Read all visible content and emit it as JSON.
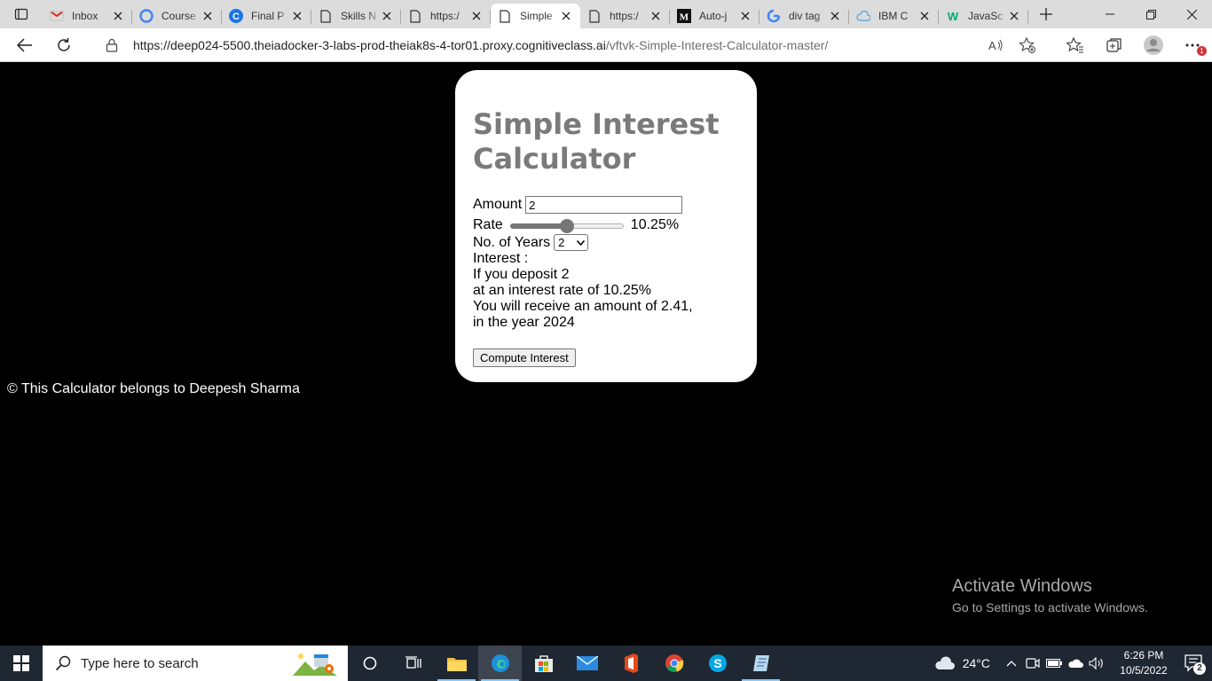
{
  "browser": {
    "tabs": [
      {
        "label": "Inbox",
        "favicon": "gmail-icon"
      },
      {
        "label": "Course",
        "favicon": "google-classroom-icon"
      },
      {
        "label": "Final P",
        "favicon": "circle-c-icon"
      },
      {
        "label": "Skills N",
        "favicon": "page-icon"
      },
      {
        "label": "https:/",
        "favicon": "page-icon"
      },
      {
        "label": "Simple",
        "favicon": "page-icon",
        "active": true
      },
      {
        "label": "https:/",
        "favicon": "page-icon"
      },
      {
        "label": "Auto-j",
        "favicon": "medium-icon"
      },
      {
        "label": "div tag",
        "favicon": "google-icon"
      },
      {
        "label": "IBM C",
        "favicon": "cloud-icon"
      },
      {
        "label": "JavaSc",
        "favicon": "w3schools-icon"
      }
    ],
    "url_main": "https://deep024-5500.theiadocker-3-labs-prod-theiak8s-4-tor01.proxy.cognitiveclass.ai",
    "url_path": "/vftvk-Simple-Interest-Calculator-master/",
    "notification_badge": "1"
  },
  "calculator": {
    "title": "Simple Interest Calculator",
    "amount_label": "Amount",
    "amount_value": "2",
    "rate_label": "Rate",
    "rate_display": "10.25%",
    "rate_fraction": 0.5,
    "years_label": "No. of Years",
    "years_value": "2",
    "interest_label": "Interest :",
    "result_line1": "If you deposit 2",
    "result_line2": "at an interest rate of 10.25%",
    "result_line3": "You will receive an amount of 2.41,",
    "result_line4": "in the year 2024",
    "compute_button": "Compute Interest"
  },
  "footer": "© This Calculator belongs to Deepesh Sharma",
  "watermark": {
    "line1": "Activate Windows",
    "line2": "Go to Settings to activate Windows."
  },
  "taskbar": {
    "search_placeholder": "Type here to search",
    "weather_temp": "24°C",
    "time": "6:26 PM",
    "date": "10/5/2022",
    "notification_count": "2"
  },
  "colors": {
    "page_bg": "#000000",
    "card_bg": "#ffffff",
    "title_color": "#7a7a7a",
    "taskbar_bg": "#1f2732"
  }
}
